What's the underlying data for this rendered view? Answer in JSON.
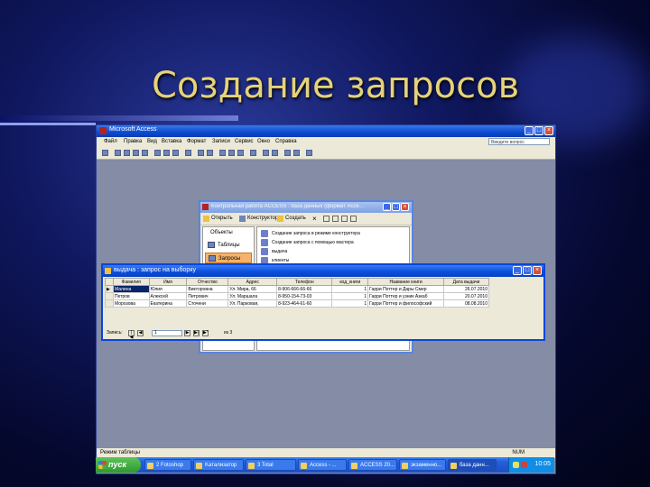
{
  "slide": {
    "title": "Создание запросов"
  },
  "app": {
    "title": "Microsoft Access",
    "menu": [
      "Файл",
      "Правка",
      "Вид",
      "Вставка",
      "Формат",
      "Записи",
      "Сервис",
      "Окно",
      "Справка"
    ],
    "help_placeholder": "Введите вопрос",
    "status": "Режим таблицы",
    "status_right": "NUM"
  },
  "db_window": {
    "title": "Контрольная работа ACCESS : база данных (формат Acce…",
    "open": "Открыть",
    "constructor": "Конструктор",
    "create": "Создать",
    "sidebar_header": "Объекты",
    "sidebar_items": [
      "Таблицы",
      "Запросы"
    ],
    "list_items": [
      "Создание запроса в режиме конструктора",
      "Создание запроса с помощью мастера",
      "выдача",
      "клиенты"
    ]
  },
  "query_window": {
    "title": "выдача : запрос на выборку",
    "columns": [
      "Фамилия",
      "Имя",
      "Отчество",
      "Адрес",
      "Телефон",
      "код_книги",
      "Название книги",
      "Дата выдачи"
    ],
    "rows": [
      [
        "Малина",
        "Юлия",
        "Викторовна",
        "Ул. Мира, 66",
        "8-906-666-66-66",
        "1",
        "Гарри Поттер и Дары Смер",
        "26.07.2010"
      ],
      [
        "Петров",
        "Алексей",
        "Петрович",
        "Ул. Маршала",
        "8-950-154-73-03",
        "1",
        "Гарри Поттер и узник Азкаб",
        "20.07.2010"
      ],
      [
        "Морозова",
        "Екатерина",
        "Сточени",
        "Ул. Парковая,",
        "8-923-464-61-60",
        "1",
        "Гарри Поттер и философский",
        "08.08.2010"
      ]
    ],
    "nav_label": "Запись:",
    "nav_current": "1",
    "nav_total": "из 3"
  },
  "taskbar": {
    "start": "пуск",
    "tasks": [
      "2 Fotoshop",
      "Kатализатор",
      "3 Total",
      "Access - ...",
      "ACCESS 20...",
      "экзаменно...",
      "база данн..."
    ],
    "clock": "10:05"
  }
}
